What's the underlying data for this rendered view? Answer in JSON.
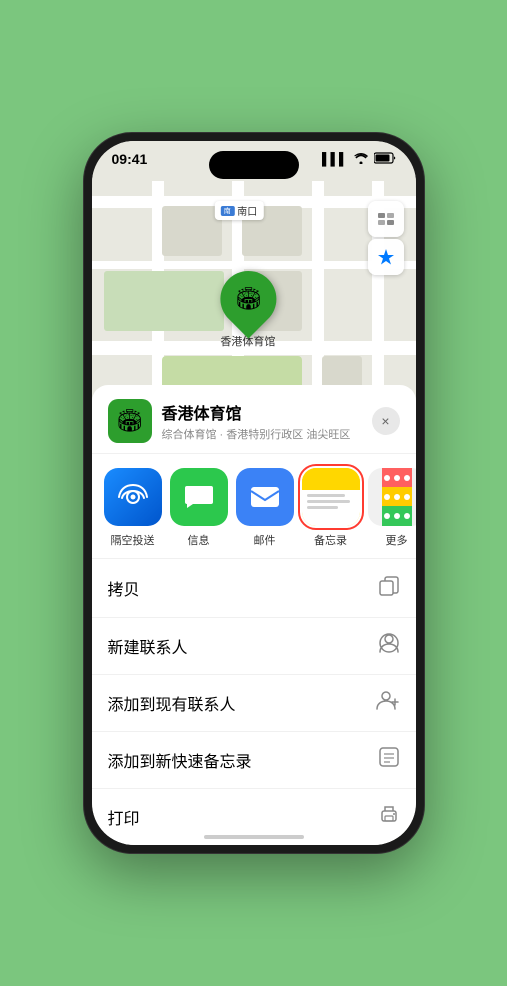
{
  "status_bar": {
    "time": "09:41",
    "signal_icon": "▌▌▌",
    "wifi_icon": "WiFi",
    "battery_icon": "🔋"
  },
  "map": {
    "label_text": "南口",
    "pin_label": "香港体育馆",
    "controls": {
      "map_type": "🗺",
      "location": "➤"
    }
  },
  "venue_card": {
    "name": "香港体育馆",
    "subtitle": "综合体育馆 · 香港特别行政区 油尖旺区",
    "close_label": "×"
  },
  "share_items": [
    {
      "id": "airdrop",
      "label": "隔空投送",
      "type": "airdrop"
    },
    {
      "id": "messages",
      "label": "信息",
      "type": "messages"
    },
    {
      "id": "mail",
      "label": "邮件",
      "type": "mail"
    },
    {
      "id": "notes",
      "label": "备忘录",
      "type": "notes",
      "selected": true
    },
    {
      "id": "more",
      "label": "更多",
      "type": "more-apps"
    }
  ],
  "actions": [
    {
      "id": "copy",
      "label": "拷贝",
      "icon": "copy"
    },
    {
      "id": "new-contact",
      "label": "新建联系人",
      "icon": "person"
    },
    {
      "id": "add-existing",
      "label": "添加到现有联系人",
      "icon": "person-plus"
    },
    {
      "id": "add-note",
      "label": "添加到新快速备忘录",
      "icon": "note"
    },
    {
      "id": "print",
      "label": "打印",
      "icon": "printer"
    }
  ]
}
